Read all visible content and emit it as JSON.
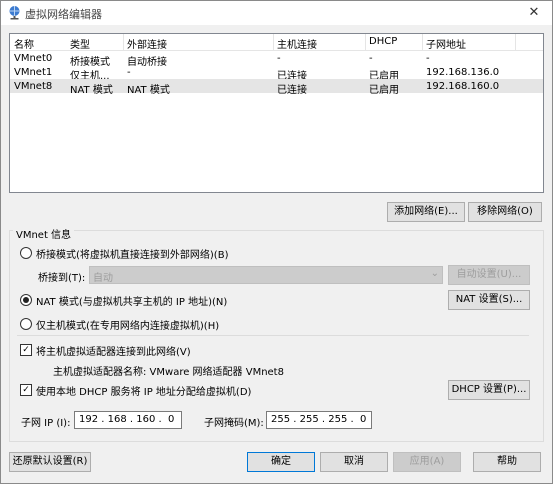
{
  "window": {
    "title": "虚拟网络编辑器",
    "close_glyph": "✕"
  },
  "table": {
    "headers": [
      "名称",
      "类型",
      "外部连接",
      "主机连接",
      "DHCP",
      "子网地址"
    ],
    "rows": [
      [
        "VMnet0",
        "桥接模式",
        "自动桥接",
        "-",
        "-",
        "-"
      ],
      [
        "VMnet1",
        "仅主机...",
        "-",
        "已连接",
        "已启用",
        "192.168.136.0"
      ],
      [
        "VMnet8",
        "NAT 模式",
        "NAT 模式",
        "已连接",
        "已启用",
        "192.168.160.0"
      ]
    ],
    "selected_row": "VMnet8"
  },
  "buttons": {
    "add_network": "添加网络(E)...",
    "remove_network": "移除网络(O)"
  },
  "vmnet_info": {
    "group_label": "VMnet 信息",
    "bridged_label": "桥接模式(将虚拟机直接连接到外部网络)(B)",
    "bridged_to_label": "桥接到(T):",
    "bridged_to_value": "自动",
    "auto_settings": "自动设置(U)...",
    "nat_label": "NAT 模式(与虚拟机共享主机的 IP 地址)(N)",
    "nat_settings": "NAT 设置(S)...",
    "hostonly_label": "仅主机模式(在专用网络内连接虚拟机)(H)",
    "selected_mode": "nat",
    "connect_adapter_label": "将主机虚拟适配器连接到此网络(V)",
    "connect_adapter_checked": true,
    "adapter_name_label": "主机虚拟适配器名称: VMware 网络适配器 VMnet8",
    "dhcp_label": "使用本地 DHCP 服务将 IP 地址分配给虚拟机(D)",
    "dhcp_checked": true,
    "dhcp_settings": "DHCP 设置(P)...",
    "subnet_ip_label": "子网 IP (I):",
    "subnet_ip_value": "192 . 168 . 160 .  0",
    "subnet_mask_label": "子网掩码(M):",
    "subnet_mask_value": "255 . 255 . 255 .  0"
  },
  "footer": {
    "restore_defaults": "还原默认设置(R)",
    "ok": "确定",
    "cancel": "取消",
    "apply": "应用(A)",
    "help": "帮助"
  },
  "icons": {
    "title": "network-globe-icon",
    "dropdown": "chevron-down-icon",
    "check": "checkmark-icon"
  },
  "colors": {
    "selection": "#e5e5e5",
    "button": "#e1e1e1",
    "focus": "#0078d7"
  }
}
